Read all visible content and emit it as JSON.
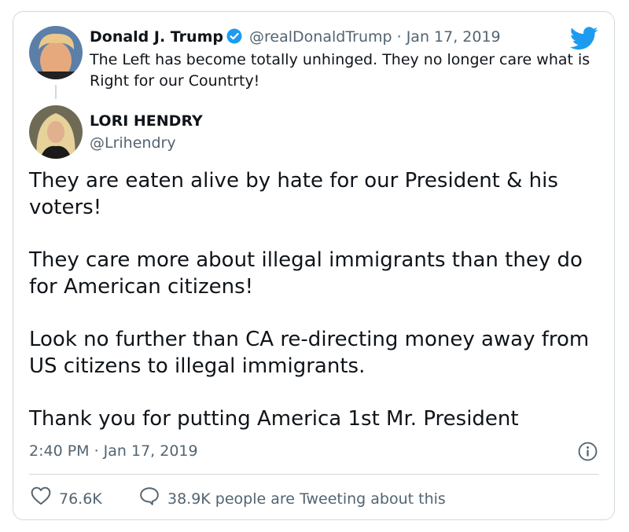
{
  "quoted_tweet": {
    "name": "Donald J. Trump",
    "handle": "@realDonaldTrump",
    "separator": "·",
    "date": "Jan 17, 2019",
    "text": "The Left has become totally unhinged. They no longer care what is Right for our Countrty!"
  },
  "main_tweet": {
    "name": "LORI HENDRY",
    "handle": "@Lrihendry",
    "paragraphs": [
      "They are eaten alive by hate for our President & his voters!",
      "They care more about illegal immigrants than they do for American citizens!",
      "Look no further than CA re-directing money away from US citizens to illegal immigrants.",
      "Thank you for putting America 1st Mr. President"
    ],
    "timestamp": "2:40 PM · Jan 17, 2019"
  },
  "actions": {
    "likes": "76.6K",
    "conversation": "38.9K people are Tweeting about this"
  },
  "icons": [
    "twitter-bird-icon",
    "verified-badge-icon",
    "info-icon",
    "heart-icon",
    "speech-bubble-icon"
  ],
  "colors": {
    "brand_blue": "#1d9bf0",
    "text_primary": "#0f1419",
    "text_secondary": "#536471",
    "border": "#cfd9de"
  }
}
